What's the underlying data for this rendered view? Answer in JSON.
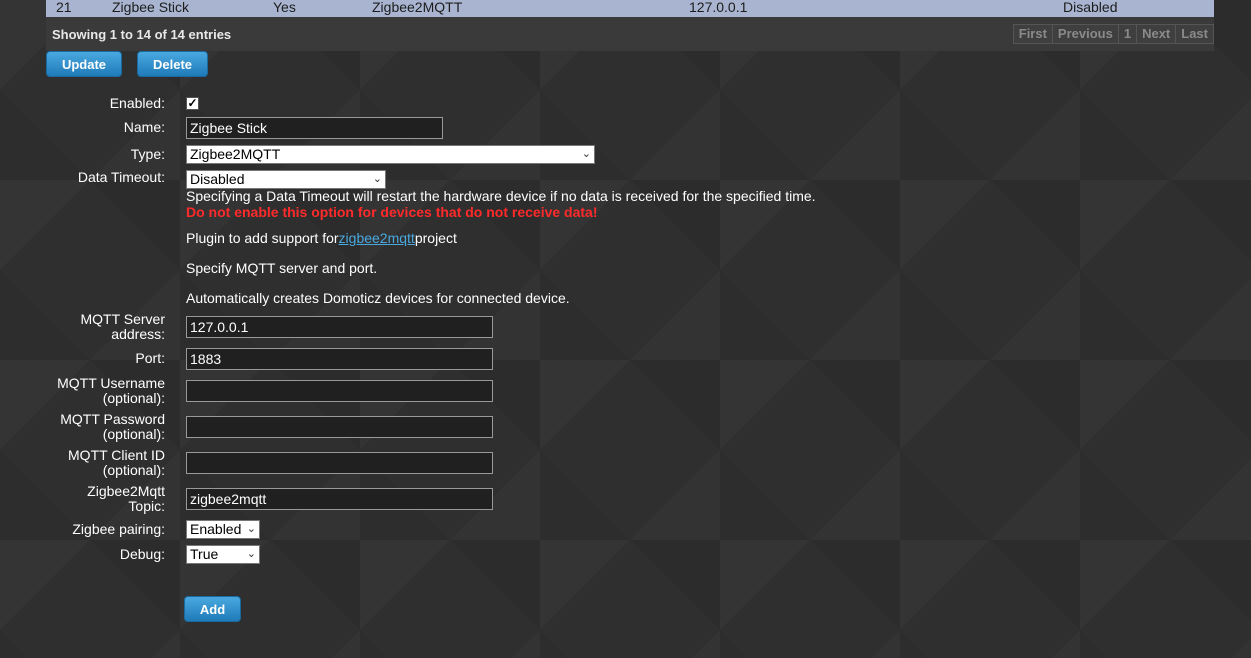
{
  "table_row": {
    "idx": "21",
    "name": "Zigbee Stick",
    "enabled": "Yes",
    "type": "Zigbee2MQTT",
    "address": "127.0.0.1",
    "timeout": "Disabled"
  },
  "table_info": "Showing 1 to 14 of 14 entries",
  "pager": {
    "first": "First",
    "previous": "Previous",
    "page": "1",
    "next": "Next",
    "last": "Last"
  },
  "buttons": {
    "update": "Update",
    "delete": "Delete",
    "add": "Add"
  },
  "form": {
    "enabled_label": "Enabled:",
    "name_label": "Name:",
    "name_value": "Zigbee Stick",
    "type_label": "Type:",
    "type_value": "Zigbee2MQTT",
    "timeout_label": "Data Timeout:",
    "timeout_value": "Disabled",
    "timeout_help": "Specifying a Data Timeout will restart the hardware device if no data is received for the specified time.",
    "timeout_warning": "Do not enable this option for devices that do not receive data!",
    "plugin_desc_prefix": "Plugin to add support for",
    "plugin_link": "zigbee2mqtt",
    "plugin_desc_suffix": "project",
    "plugin_desc_2": "Specify MQTT server and port.",
    "plugin_desc_3": "Automatically creates Domoticz devices for connected device.",
    "server_label_1": "MQTT Server",
    "server_label_2": "address:",
    "server_value": "127.0.0.1",
    "port_label": "Port:",
    "port_value": "1883",
    "username_label_1": "MQTT Username",
    "username_label_2": "(optional):",
    "username_value": "",
    "password_label_1": "MQTT Password",
    "password_label_2": "(optional):",
    "password_value": "",
    "clientid_label_1": "MQTT Client ID",
    "clientid_label_2": "(optional):",
    "clientid_value": "",
    "topic_label_1": "Zigbee2Mqtt",
    "topic_label_2": "Topic:",
    "topic_value": "zigbee2mqtt",
    "pairing_label": "Zigbee pairing:",
    "pairing_value": "Enabled",
    "debug_label": "Debug:",
    "debug_value": "True"
  },
  "icons": {
    "checkbox": "checkmark-icon",
    "dropdown": "chevron-down-icon"
  }
}
